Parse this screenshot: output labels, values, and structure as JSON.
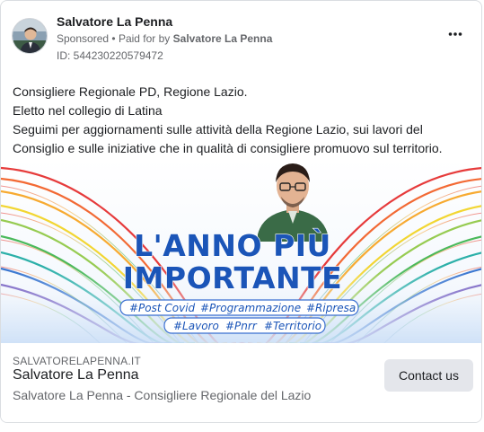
{
  "post": {
    "advertiser": "Salvatore La Penna",
    "sponsored": "Sponsored",
    "separator": "•",
    "paid_for_prefix": "Paid for by",
    "paid_for_by": "Salvatore La Penna",
    "ad_id": "ID: 544230220579472",
    "more_icon": "more-horizontal-icon"
  },
  "ad_text": {
    "lines": [
      "Consigliere Regionale PD, Regione Lazio.",
      "Eletto nel collegio di Latina",
      "Seguimi per aggiornamenti sulle attività della Regione Lazio, sui lavori del",
      "Consiglio e sulle iniziative che in qualità di consigliere promuovo sul territorio."
    ]
  },
  "creative": {
    "headline_line1": "L'ANNO PIÙ",
    "headline_line2": "IMPORTANTE",
    "hashtags_row1": [
      "#Post Covid",
      "#Programmazione",
      "#Ripresa"
    ],
    "hashtags_row2": [
      "#Lavoro",
      "#Pnrr",
      "#Territorio"
    ],
    "colors": {
      "headline": "#1b55b8",
      "hashtag_text": "#1b55b8",
      "hashtag_border": "#3a6fd1"
    }
  },
  "link": {
    "domain": "SALVATORELAPENNA.IT",
    "title": "Salvatore La Penna",
    "description": "Salvatore La Penna - Consigliere Regionale del Lazio",
    "cta": "Contact us"
  }
}
